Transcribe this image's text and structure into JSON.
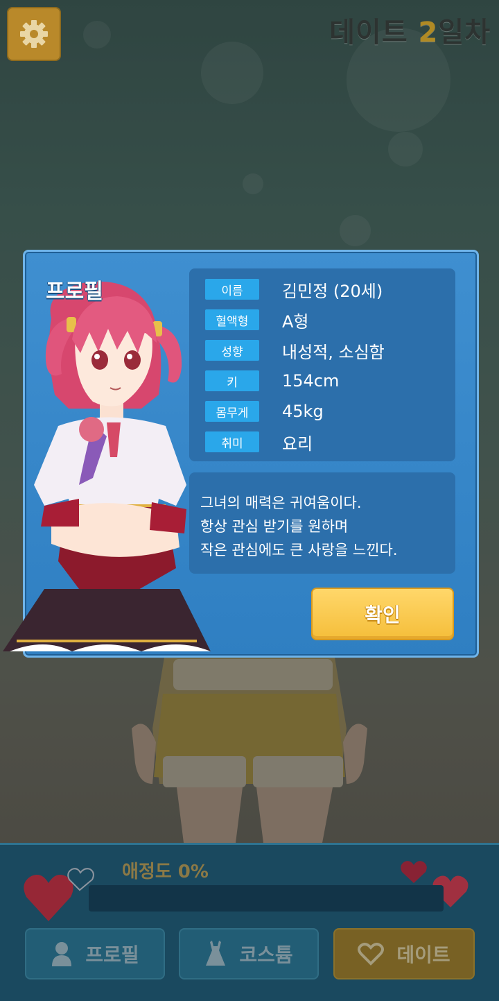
{
  "header": {
    "day_prefix": "데이트 ",
    "day_number": "2",
    "day_suffix": "일차",
    "settings_icon": "gear-icon"
  },
  "dialog": {
    "title": "프로필",
    "fields": [
      {
        "label": "이름",
        "value": "김민정 (20세)"
      },
      {
        "label": "혈액형",
        "value": "A형"
      },
      {
        "label": "성향",
        "value": "내성적, 소심함"
      },
      {
        "label": "키",
        "value": "154cm"
      },
      {
        "label": "몸무게",
        "value": "45kg"
      },
      {
        "label": "취미",
        "value": "요리"
      }
    ],
    "description": [
      "그녀의 매력은 귀여움이다.",
      "항상 관심 받기를 원하며",
      "작은 관심에도 큰 사랑을 느낀다."
    ],
    "confirm_label": "확인"
  },
  "bottom": {
    "affection_label": "애정도 0%",
    "affection_value": 0,
    "nav": [
      {
        "label": "프로필",
        "icon": "person-icon"
      },
      {
        "label": "코스튬",
        "icon": "dress-icon"
      },
      {
        "label": "데이트",
        "icon": "heart-icon"
      }
    ]
  },
  "colors": {
    "dialog_bg": "#3f8fd0",
    "label_bg": "#2aa7ea",
    "confirm_bg": "#f5be3a",
    "affection_fill": "#e0495e"
  }
}
